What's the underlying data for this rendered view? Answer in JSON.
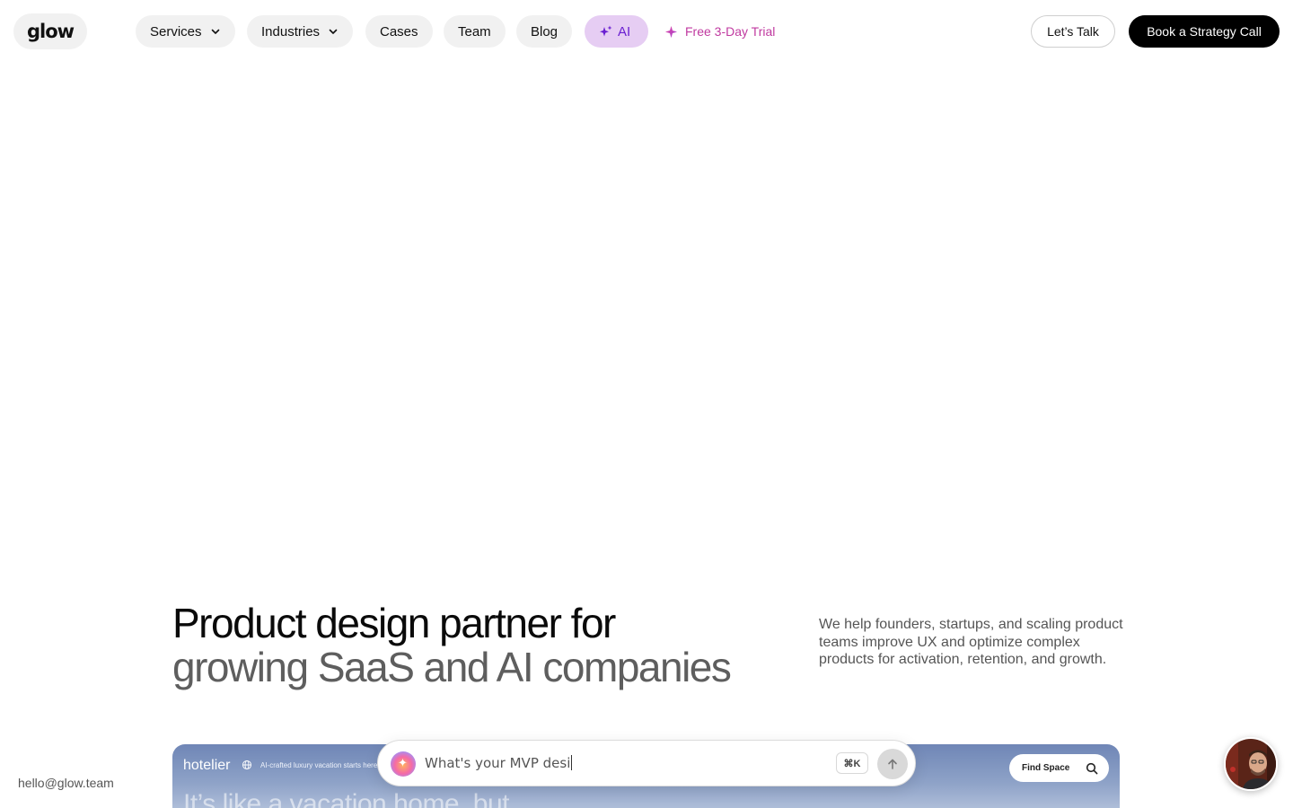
{
  "header": {
    "logo": "glow",
    "nav": [
      {
        "label": "Services",
        "dropdown": true
      },
      {
        "label": "Industries",
        "dropdown": true
      },
      {
        "label": "Cases"
      },
      {
        "label": "Team"
      },
      {
        "label": "Blog"
      }
    ],
    "ai_label": "AI",
    "trial_label": "Free 3-Day Trial",
    "talk_label": "Let’s Talk",
    "cta_label": "Book a Strategy Call"
  },
  "hero": {
    "title_line1": "Product design partner for",
    "title_line2": "growing SaaS and AI companies",
    "description": "We help founders, startups, and scaling product teams improve UX and optimize complex products for activation, retention, and growth."
  },
  "preview": {
    "brand": "hotelier",
    "tagline": "AI-crafted luxury vacation starts here",
    "find_label": "Find Space",
    "headline": "It’s like a vacation home, but"
  },
  "chat": {
    "value": "What's your MVP desi",
    "shortcut": "⌘K"
  },
  "footer": {
    "email": "hello@glow.team"
  },
  "colors": {
    "ai_bg": "#e6cdf3",
    "ai_text": "#6a1fd1",
    "trial": "#c03aa0",
    "cta_bg": "#000000"
  }
}
